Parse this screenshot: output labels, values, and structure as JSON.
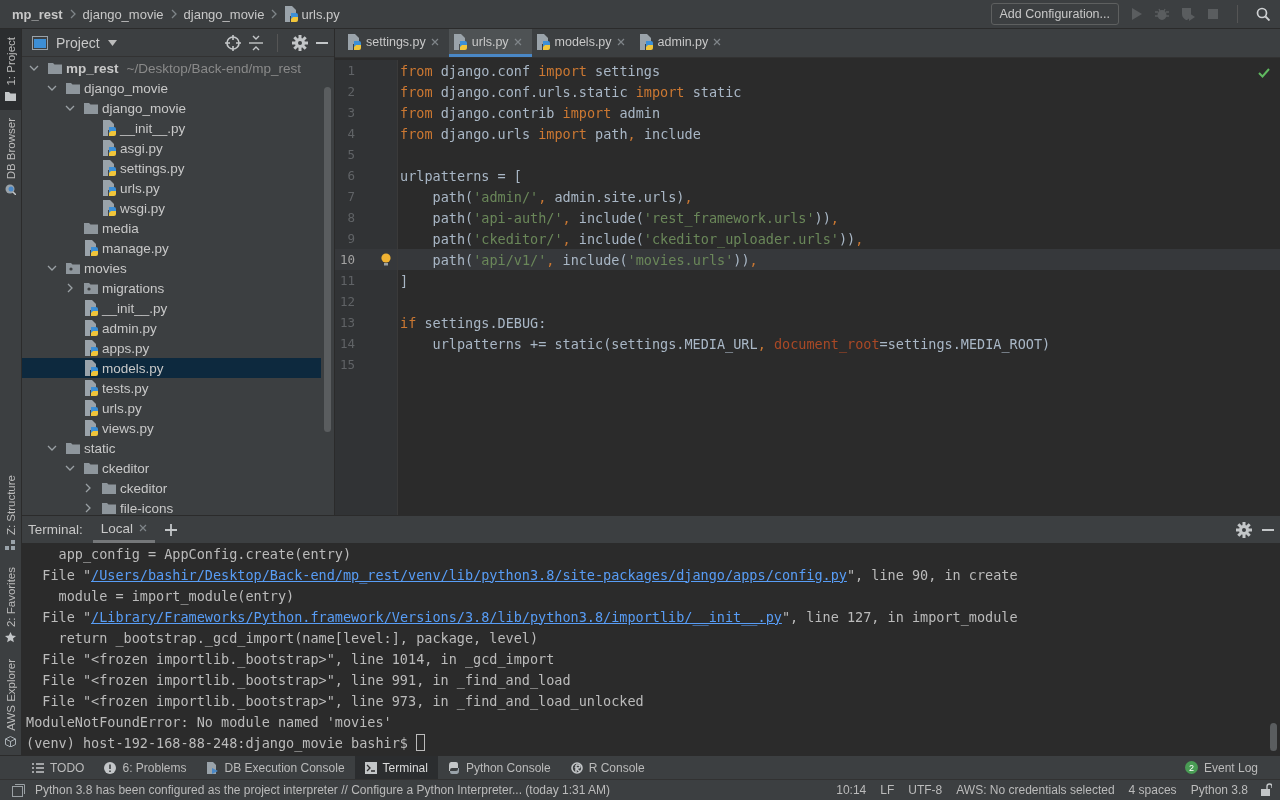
{
  "breadcrumbs": [
    {
      "label": "mp_rest",
      "kind": "project"
    },
    {
      "label": "django_movie",
      "kind": "folder"
    },
    {
      "label": "django_movie",
      "kind": "folder"
    },
    {
      "label": "urls.py",
      "kind": "python"
    }
  ],
  "toolbar": {
    "run_config": "Add Configuration..."
  },
  "left_stripe": [
    {
      "label": "1: Project",
      "selected": true,
      "kind": "folder"
    },
    {
      "label": "DB Browser",
      "selected": false,
      "kind": "db"
    },
    {
      "label": "Z: Structure",
      "selected": false,
      "kind": "structure"
    },
    {
      "label": "2: Favorites",
      "selected": false,
      "kind": "star"
    },
    {
      "label": "AWS Explorer",
      "selected": false,
      "kind": "cube"
    }
  ],
  "project_panel": {
    "title": "Project",
    "tree": [
      {
        "label": "mp_rest",
        "hint": "~/Desktop/Back-end/mp_rest",
        "kind": "folder",
        "expanded": true,
        "selected": false,
        "children": [
          {
            "label": "django_movie",
            "kind": "folder",
            "expanded": true,
            "selected": false,
            "children": [
              {
                "label": "django_movie",
                "kind": "folder",
                "expanded": true,
                "selected": false,
                "children": [
                  {
                    "label": "__init__.py",
                    "kind": "python",
                    "selected": false
                  },
                  {
                    "label": "asgi.py",
                    "kind": "python",
                    "selected": false
                  },
                  {
                    "label": "settings.py",
                    "kind": "python",
                    "selected": false
                  },
                  {
                    "label": "urls.py",
                    "kind": "python",
                    "selected": false
                  },
                  {
                    "label": "wsgi.py",
                    "kind": "python",
                    "selected": false
                  }
                ]
              },
              {
                "label": "media",
                "kind": "folder",
                "selected": false
              },
              {
                "label": "manage.py",
                "kind": "python",
                "selected": false
              }
            ]
          },
          {
            "label": "movies",
            "kind": "package",
            "expanded": true,
            "selected": false,
            "children": [
              {
                "label": "migrations",
                "kind": "package",
                "expanded": false,
                "selected": false
              },
              {
                "label": "__init__.py",
                "kind": "python",
                "selected": false
              },
              {
                "label": "admin.py",
                "kind": "python",
                "selected": false
              },
              {
                "label": "apps.py",
                "kind": "python",
                "selected": false
              },
              {
                "label": "models.py",
                "kind": "python",
                "selected": true
              },
              {
                "label": "tests.py",
                "kind": "python",
                "selected": false
              },
              {
                "label": "urls.py",
                "kind": "python",
                "selected": false
              },
              {
                "label": "views.py",
                "kind": "python",
                "selected": false
              }
            ]
          },
          {
            "label": "static",
            "kind": "folder",
            "expanded": true,
            "selected": false,
            "children": [
              {
                "label": "ckeditor",
                "kind": "folder",
                "expanded": true,
                "selected": false,
                "children": [
                  {
                    "label": "ckeditor",
                    "kind": "folder",
                    "expanded": false,
                    "selected": false
                  },
                  {
                    "label": "file-icons",
                    "kind": "folder",
                    "expanded": false,
                    "selected": false
                  }
                ]
              }
            ]
          }
        ]
      }
    ]
  },
  "editor_tabs": [
    {
      "label": "settings.py",
      "selected": false
    },
    {
      "label": "urls.py",
      "selected": true
    },
    {
      "label": "models.py",
      "selected": false
    },
    {
      "label": "admin.py",
      "selected": false
    }
  ],
  "code_lines": [
    {
      "number": "1",
      "current": false,
      "tokens": [
        {
          "text": "from",
          "kind": "keyword"
        },
        {
          "text": " django.conf ",
          "kind": "plain"
        },
        {
          "text": "import",
          "kind": "keyword"
        },
        {
          "text": " settings",
          "kind": "plain"
        }
      ]
    },
    {
      "number": "2",
      "current": false,
      "tokens": [
        {
          "text": "from",
          "kind": "keyword"
        },
        {
          "text": " django.conf.urls.static ",
          "kind": "plain"
        },
        {
          "text": "import",
          "kind": "keyword"
        },
        {
          "text": " static",
          "kind": "plain"
        }
      ]
    },
    {
      "number": "3",
      "current": false,
      "tokens": [
        {
          "text": "from",
          "kind": "keyword"
        },
        {
          "text": " django.contrib ",
          "kind": "plain"
        },
        {
          "text": "import",
          "kind": "keyword"
        },
        {
          "text": " admin",
          "kind": "plain"
        }
      ]
    },
    {
      "number": "4",
      "current": false,
      "tokens": [
        {
          "text": "from",
          "kind": "keyword"
        },
        {
          "text": " django.urls ",
          "kind": "plain"
        },
        {
          "text": "import",
          "kind": "keyword"
        },
        {
          "text": " path",
          "kind": "plain"
        },
        {
          "text": ",",
          "kind": "comma"
        },
        {
          "text": " include",
          "kind": "plain"
        }
      ]
    },
    {
      "number": "5",
      "current": false
    },
    {
      "number": "6",
      "current": false,
      "tokens": [
        {
          "text": "urlpatterns = [",
          "kind": "plain"
        }
      ]
    },
    {
      "number": "7",
      "current": false,
      "tokens": [
        {
          "text": "    path(",
          "kind": "plain"
        },
        {
          "text": "'admin/'",
          "kind": "string"
        },
        {
          "text": ",",
          "kind": "comma"
        },
        {
          "text": " admin.site.urls)",
          "kind": "plain"
        },
        {
          "text": ",",
          "kind": "comma"
        }
      ]
    },
    {
      "number": "8",
      "current": false,
      "tokens": [
        {
          "text": "    path(",
          "kind": "plain"
        },
        {
          "text": "'api-auth/'",
          "kind": "string"
        },
        {
          "text": ",",
          "kind": "comma"
        },
        {
          "text": " include(",
          "kind": "plain"
        },
        {
          "text": "'rest_framework.urls'",
          "kind": "string"
        },
        {
          "text": "))",
          "kind": "plain"
        },
        {
          "text": ",",
          "kind": "comma"
        }
      ]
    },
    {
      "number": "9",
      "current": false,
      "tokens": [
        {
          "text": "    path(",
          "kind": "plain"
        },
        {
          "text": "'ckeditor/'",
          "kind": "string"
        },
        {
          "text": ",",
          "kind": "comma"
        },
        {
          "text": " include(",
          "kind": "plain"
        },
        {
          "text": "'ckeditor_uploader.urls'",
          "kind": "string"
        },
        {
          "text": "))",
          "kind": "plain"
        },
        {
          "text": ",",
          "kind": "comma"
        }
      ]
    },
    {
      "number": "10",
      "current": true,
      "tokens": [
        {
          "text": "    path(",
          "kind": "plain"
        },
        {
          "text": "'api/v1/'",
          "kind": "string"
        },
        {
          "text": ",",
          "kind": "comma"
        },
        {
          "text": " include(",
          "kind": "plain"
        },
        {
          "text": "'movies.urls'",
          "kind": "string"
        },
        {
          "text": "))",
          "kind": "plain"
        },
        {
          "text": ",",
          "kind": "comma"
        }
      ]
    },
    {
      "number": "11",
      "current": false,
      "tokens": [
        {
          "text": "]",
          "kind": "plain"
        }
      ]
    },
    {
      "number": "12",
      "current": false
    },
    {
      "number": "13",
      "current": false,
      "tokens": [
        {
          "text": "if",
          "kind": "keyword"
        },
        {
          "text": " settings.DEBUG:",
          "kind": "plain"
        }
      ]
    },
    {
      "number": "14",
      "current": false,
      "tokens": [
        {
          "text": "    urlpatterns += static(settings.MEDIA_URL",
          "kind": "plain"
        },
        {
          "text": ", ",
          "kind": "comma"
        },
        {
          "text": "document_root",
          "kind": "param"
        },
        {
          "text": "=settings.MEDIA_ROOT)",
          "kind": "plain"
        }
      ]
    },
    {
      "number": "15",
      "current": false
    }
  ],
  "terminal": {
    "title": "Terminal:",
    "tabs": [
      {
        "label": "Local",
        "selected": true
      }
    ],
    "lines": [
      [
        {
          "text": "    app_config = AppConfig.create(entry)",
          "kind": "plain"
        }
      ],
      [
        {
          "text": "  File \"",
          "kind": "plain"
        },
        {
          "text": "/Users/bashir/Desktop/Back-end/mp_rest/venv/lib/python3.8/site-packages/django/apps/config.py",
          "kind": "link"
        },
        {
          "text": "\", line 90, in create",
          "kind": "plain"
        }
      ],
      [
        {
          "text": "    module = import_module(entry)",
          "kind": "plain"
        }
      ],
      [
        {
          "text": "  File \"",
          "kind": "plain"
        },
        {
          "text": "/Library/Frameworks/Python.framework/Versions/3.8/lib/python3.8/importlib/__init__.py",
          "kind": "link"
        },
        {
          "text": "\", line 127, in import_module",
          "kind": "plain"
        }
      ],
      [
        {
          "text": "    return _bootstrap._gcd_import(name[level:], package, level)",
          "kind": "plain"
        }
      ],
      [
        {
          "text": "  File \"<frozen importlib._bootstrap>\", line 1014, in _gcd_import",
          "kind": "plain"
        }
      ],
      [
        {
          "text": "  File \"<frozen importlib._bootstrap>\", line 991, in _find_and_load",
          "kind": "plain"
        }
      ],
      [
        {
          "text": "  File \"<frozen importlib._bootstrap>\", line 973, in _find_and_load_unlocked",
          "kind": "plain"
        }
      ],
      [
        {
          "text": "ModuleNotFoundError: No module named 'movies'",
          "kind": "plain"
        }
      ],
      [
        {
          "text": "(venv) host-192-168-88-248:django_movie bashir$ ",
          "kind": "plain"
        }
      ]
    ]
  },
  "tool_windows": [
    {
      "label": "TODO",
      "kind": "list",
      "selected": false
    },
    {
      "label": "6: Problems",
      "kind": "problems",
      "selected": false
    },
    {
      "label": "DB Execution Console",
      "kind": "db",
      "selected": false
    },
    {
      "label": "Terminal",
      "kind": "terminal",
      "selected": true
    },
    {
      "label": "Python Console",
      "kind": "python",
      "selected": false
    },
    {
      "label": "R Console",
      "kind": "r",
      "selected": false
    }
  ],
  "event_log": {
    "label": "Event Log",
    "count": "2"
  },
  "status_bar": {
    "message": "Python 3.8 has been configured as the project interpreter // Configure a Python Interpreter... (today 1:31 AM)",
    "items": [
      "10:14",
      "LF",
      "UTF-8",
      "AWS: No credentials selected",
      "4 spaces",
      "Python 3.8"
    ]
  }
}
